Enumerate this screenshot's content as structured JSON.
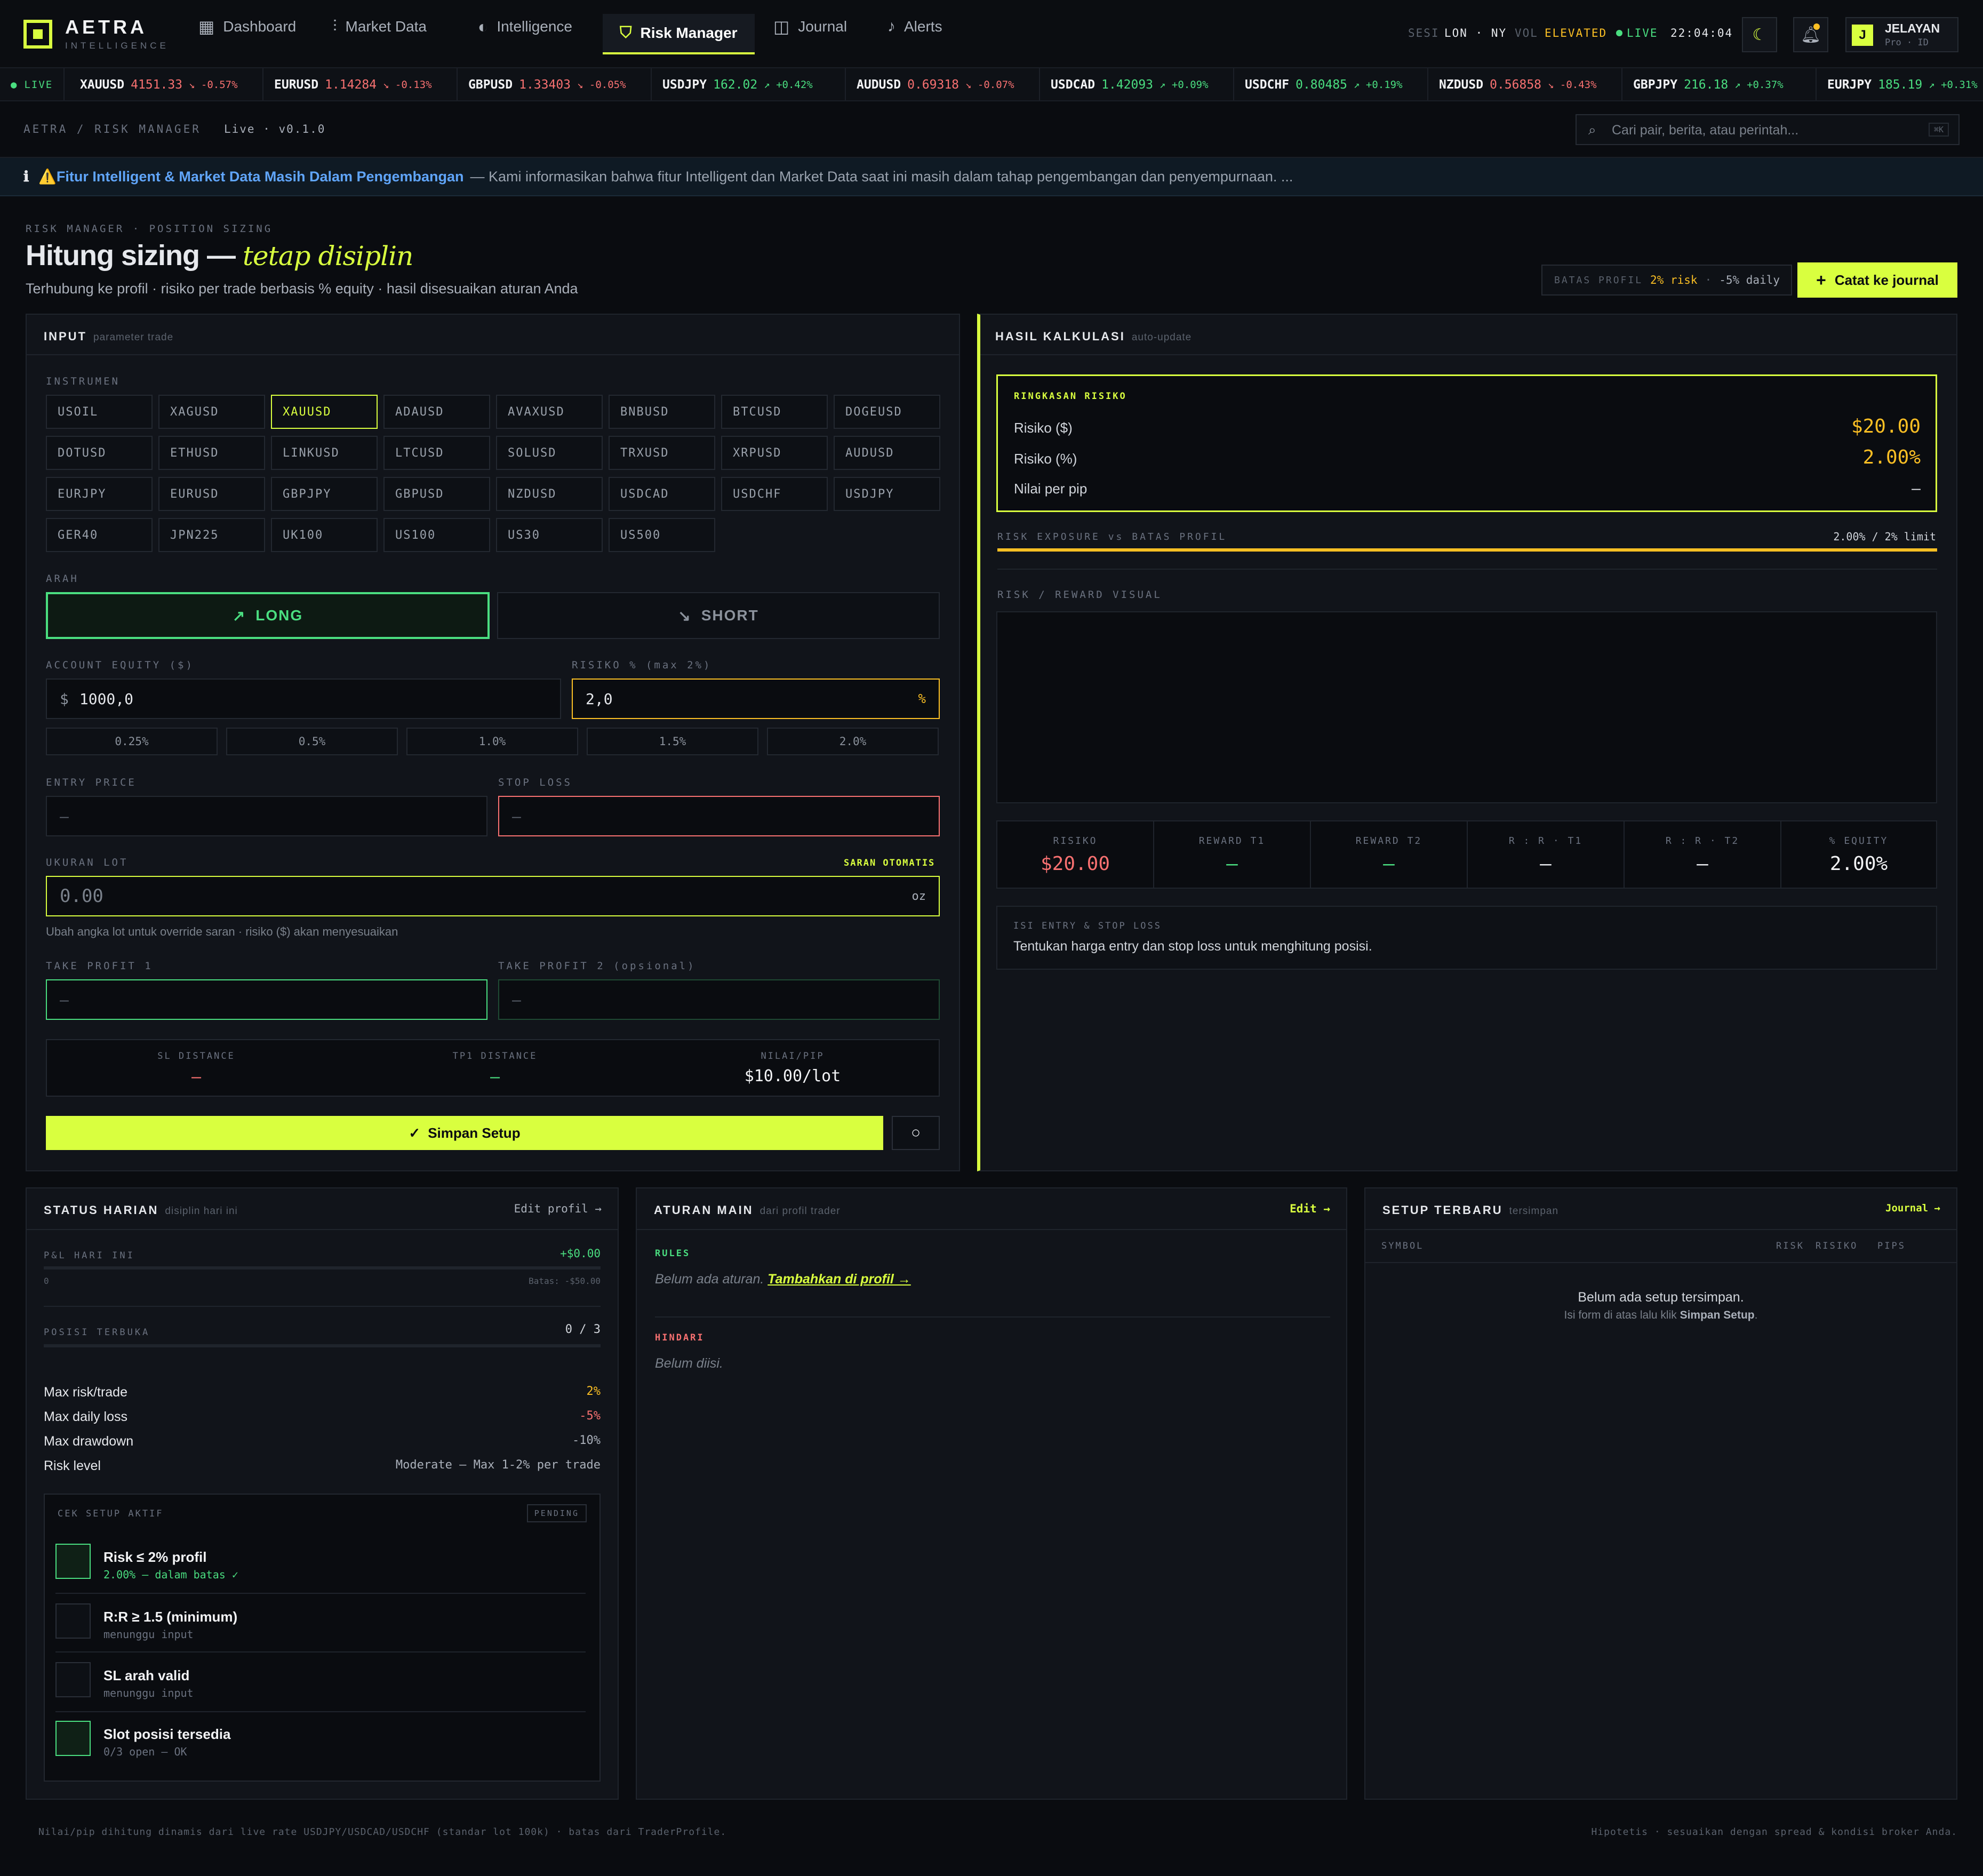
{
  "brand": {
    "name": "AETRA",
    "sub": "INTELLIGENCE"
  },
  "nav": [
    {
      "label": "Dashboard"
    },
    {
      "label": "Market Data"
    },
    {
      "label": "Intelligence"
    },
    {
      "label": "Risk Manager"
    },
    {
      "label": "Journal"
    },
    {
      "label": "Alerts"
    }
  ],
  "session": {
    "label": "SESI",
    "value": "LON · NY",
    "vol_label": "VOL",
    "vol_value": "ELEVATED",
    "live": "LIVE",
    "time": "22:04:04"
  },
  "user": {
    "initial": "J",
    "name": "JELAYAN",
    "plan": "Pro · ID"
  },
  "ticker_live": "LIVE",
  "ticker": [
    {
      "sym": "XAUUSD",
      "price": "4151.33",
      "chg": "↘ -0.57%",
      "dir": "dn"
    },
    {
      "sym": "EURUSD",
      "price": "1.14284",
      "chg": "↘ -0.13%",
      "dir": "dn"
    },
    {
      "sym": "GBPUSD",
      "price": "1.33403",
      "chg": "↘ -0.05%",
      "dir": "dn"
    },
    {
      "sym": "USDJPY",
      "price": "162.02",
      "chg": "↗ +0.42%",
      "dir": "up"
    },
    {
      "sym": "AUDUSD",
      "price": "0.69318",
      "chg": "↘ -0.07%",
      "dir": "dn"
    },
    {
      "sym": "USDCAD",
      "price": "1.42093",
      "chg": "↗ +0.09%",
      "dir": "up"
    },
    {
      "sym": "USDCHF",
      "price": "0.80485",
      "chg": "↗ +0.19%",
      "dir": "up"
    },
    {
      "sym": "NZDUSD",
      "price": "0.56858",
      "chg": "↘ -0.43%",
      "dir": "dn"
    },
    {
      "sym": "GBPJPY",
      "price": "216.18",
      "chg": "↗ +0.37%",
      "dir": "up"
    },
    {
      "sym": "EURJPY",
      "price": "185.19",
      "chg": "↗ +0.31%",
      "dir": "up"
    }
  ],
  "breadcrumb": {
    "path": "AETRA / RISK MANAGER",
    "status": "Live · v0.1.0"
  },
  "search": {
    "placeholder": "Cari pair, berita, atau perintah...",
    "kbd": "⌘K"
  },
  "banner": {
    "title": "⚠️Fitur Intelligent & Market Data Masih Dalam Pengembangan",
    "text": "— Kami informasikan bahwa fitur Intelligent dan Market Data saat ini masih dalam tahap pengembangan dan penyempurnaan. ..."
  },
  "header": {
    "kicker": "RISK MANAGER · POSITION SIZING",
    "title": "Hitung sizing —",
    "title_em": "tetap disiplin",
    "subtitle": "Terhubung ke profil · risiko per trade berbasis % equity · hasil disesuaikan aturan Anda",
    "limit_label": "BATAS PROFIL",
    "limit_risk": "2% risk",
    "limit_daily": "-5% daily",
    "journal_btn": "Catat ke journal"
  },
  "input": {
    "title": "INPUT",
    "sub": "parameter trade",
    "instrument_label": "INSTRUMEN",
    "instruments": [
      "USOIL",
      "XAGUSD",
      "XAUUSD",
      "ADAUSD",
      "AVAXUSD",
      "BNBUSD",
      "BTCUSD",
      "DOGEUSD",
      "DOTUSD",
      "ETHUSD",
      "LINKUSD",
      "LTCUSD",
      "SOLUSD",
      "TRXUSD",
      "XRPUSD",
      "AUDUSD",
      "EURJPY",
      "EURUSD",
      "GBPJPY",
      "GBPUSD",
      "NZDUSD",
      "USDCAD",
      "USDCHF",
      "USDJPY",
      "GER40",
      "JPN225",
      "UK100",
      "US100",
      "US30",
      "US500"
    ],
    "selected": "XAUUSD",
    "direction_label": "ARAH",
    "long": "LONG",
    "short": "SHORT",
    "equity_label": "ACCOUNT EQUITY ($)",
    "equity_prefix": "$",
    "equity": "1000,0",
    "risk_label": "RISIKO % (max 2%)",
    "risk": "2,0",
    "risk_suffix": "%",
    "presets": [
      "0.25%",
      "0.5%",
      "1.0%",
      "1.5%",
      "2.0%"
    ],
    "entry_label": "ENTRY PRICE",
    "entry": "—",
    "sl_label": "STOP LOSS",
    "sl": "—",
    "lot_label": "UKURAN LOT",
    "lot_auto": "SARAN OTOMATIS",
    "lot": "0.00",
    "lot_unit": "oz",
    "lot_hint": "Ubah angka lot untuk override saran · risiko ($) akan menyesuaikan",
    "tp1_label": "TAKE PROFIT 1",
    "tp1": "—",
    "tp2_label": "TAKE PROFIT 2 (opsional)",
    "tp2": "—",
    "sl_dist_label": "SL DISTANCE",
    "sl_dist": "—",
    "tp1_dist_label": "TP1 DISTANCE",
    "tp1_dist": "—",
    "pip_label": "NILAI/PIP",
    "pip": "$10.00/lot",
    "save": "Simpan Setup"
  },
  "result": {
    "title": "HASIL KALKULASI",
    "sub": "auto-update",
    "summary_label": "RINGKASAN RISIKO",
    "rows": [
      {
        "k": "Risiko ($)",
        "v": "$20.00"
      },
      {
        "k": "Risiko (%)",
        "v": "2.00%"
      },
      {
        "k": "Nilai per pip",
        "v": "—"
      }
    ],
    "exposure_label": "RISK EXPOSURE vs BATAS PROFIL",
    "exposure_value": "2.00% / 2% limit",
    "exposure_fraction": 1.0,
    "visual_label": "RISK / REWARD VISUAL",
    "stats": [
      {
        "k": "RISIKO",
        "v": "$20.00"
      },
      {
        "k": "REWARD T1",
        "v": "—"
      },
      {
        "k": "REWARD T2",
        "v": "—"
      },
      {
        "k": "R : R · T1",
        "v": "—"
      },
      {
        "k": "R : R · T2",
        "v": "—"
      },
      {
        "k": "% EQUITY",
        "v": "2.00%"
      }
    ],
    "hint_label": "ISI ENTRY & STOP LOSS",
    "hint": "Tentukan harga entry dan stop loss untuk menghitung posisi."
  },
  "status": {
    "title": "STATUS HARIAN",
    "sub": "disiplin hari ini",
    "edit": "Edit profil →",
    "pnl_label": "P&L HARI INI",
    "pnl": "+$0.00",
    "pnl_min": "0",
    "pnl_limit": "Batas: -$50.00",
    "pos_label": "POSISI TERBUKA",
    "pos": "0 / 3",
    "rules": [
      {
        "k": "Max risk/trade",
        "v": "2%"
      },
      {
        "k": "Max daily loss",
        "v": "-5%"
      },
      {
        "k": "Max drawdown",
        "v": "-10%"
      },
      {
        "k": "Risk level",
        "v": "Moderate — Max 1-2% per trade"
      }
    ],
    "check_label": "CEK SETUP AKTIF",
    "check_badge": "PENDING",
    "checks": [
      {
        "t": "Risk ≤ 2% profil",
        "s": "2.00% — dalam batas ✓"
      },
      {
        "t": "R:R ≥ 1.5 (minimum)",
        "s": "menunggu input"
      },
      {
        "t": "SL arah valid",
        "s": "menunggu input"
      },
      {
        "t": "Slot posisi tersedia",
        "s": "0/3 open — OK"
      }
    ]
  },
  "aturan": {
    "title": "ATURAN MAIN",
    "sub": "dari profil trader",
    "edit": "Edit →",
    "rules_label": "RULES",
    "rules_empty": "Belum ada aturan.",
    "rules_link": "Tambahkan di profil →",
    "avoid_label": "HINDARI",
    "avoid_empty": "Belum diisi."
  },
  "setup": {
    "title": "SETUP TERBARU",
    "sub": "tersimpan",
    "link": "Journal →",
    "cols": [
      "SYMBOL",
      "RISK",
      "RISIKO",
      "PIPS"
    ],
    "empty": "Belum ada setup tersimpan.",
    "empty_hint_pre": "Isi form di atas lalu klik",
    "empty_hint_bold": "Simpan Setup",
    "empty_hint_post": "."
  },
  "footer": {
    "left": "Nilai/pip dihitung dinamis dari live rate USDJPY/USDCAD/USDCHF (standar lot 100k) · batas dari TraderProfile.",
    "right": "Hipotetis · sesuaikan dengan spread & kondisi broker Anda."
  },
  "colors": {
    "accent": "#d9ff3f",
    "up": "#4ade80",
    "down": "#f87171",
    "warn": "#fbbf24"
  }
}
